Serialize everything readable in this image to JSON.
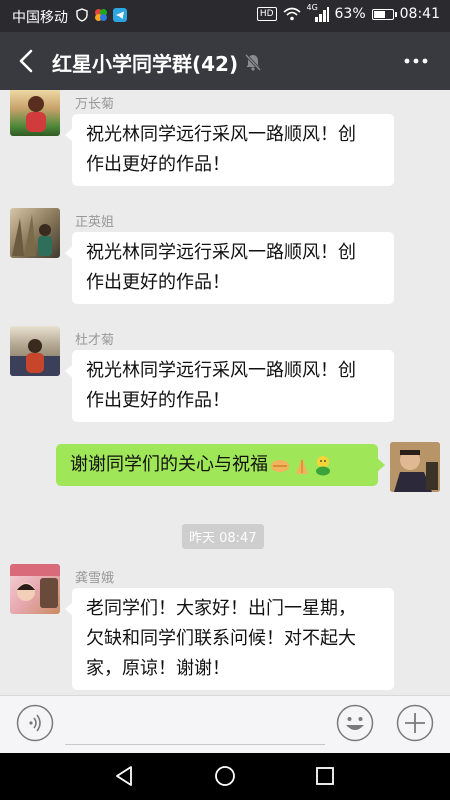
{
  "status_bar": {
    "carrier": "中国移动",
    "network": "4G",
    "hd": "HD",
    "battery": "63%",
    "battery_level": 0.63,
    "time": "08:41"
  },
  "header": {
    "title": "红星小学同学群(42)"
  },
  "messages": [
    {
      "sender": "万长菊",
      "text_lines": [
        "祝光林同学远行采风一路顺风！创",
        "作出更好的作品！"
      ]
    },
    {
      "sender": "正英姐",
      "text_lines": [
        "祝光林同学远行采风一路顺风！创",
        "作出更好的作品！"
      ]
    },
    {
      "sender": "杜才菊",
      "text_lines": [
        "祝光林同学远行采风一路顺风！创",
        "作出更好的作品！"
      ]
    },
    {
      "sender": "",
      "text": "谢谢同学们的关心与祝福"
    },
    {
      "sender": "龚雪娥",
      "text_lines": [
        "老同学们！大家好！出门一星期，",
        "欠缺和同学们联系问候！对不起大",
        "家，原谅！谢谢！"
      ]
    }
  ],
  "timestamp": "昨天 08:47",
  "icons": {
    "back": "back-arrow-icon",
    "mute": "muted-bell-icon",
    "more": "more-dots-icon",
    "voice": "voice-icon",
    "emoji": "emoji-icon",
    "add": "plus-icon"
  },
  "colors": {
    "title_bar": "#393a3f",
    "own_bubble": "#9fe658",
    "chat_bg": "#ebebeb"
  }
}
